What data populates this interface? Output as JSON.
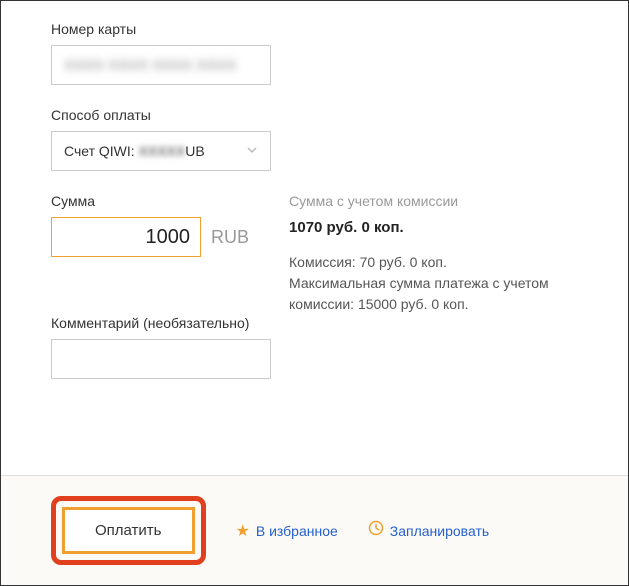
{
  "card": {
    "label": "Номер карты",
    "masked_value": "XXXX XXXX XXXX XXXX"
  },
  "payment_method": {
    "label": "Способ оплаты",
    "prefix": "Счет QIWI: ",
    "hidden": "XXXXX",
    "suffix": "UB"
  },
  "amount": {
    "label": "Сумма",
    "value": "1000",
    "currency": "RUB"
  },
  "total": {
    "label": "Сумма с учетом комиссии",
    "value": "1070 руб. 0 коп."
  },
  "fee": {
    "line1": "Комиссия: 70 руб. 0 коп.",
    "line2": "Максимальная сумма платежа с учетом комиссии: 15000 руб. 0 коп."
  },
  "comment": {
    "label": "Комментарий (необязательно)"
  },
  "actions": {
    "pay": "Оплатить",
    "favorite": "В избранное",
    "schedule": "Запланировать"
  }
}
